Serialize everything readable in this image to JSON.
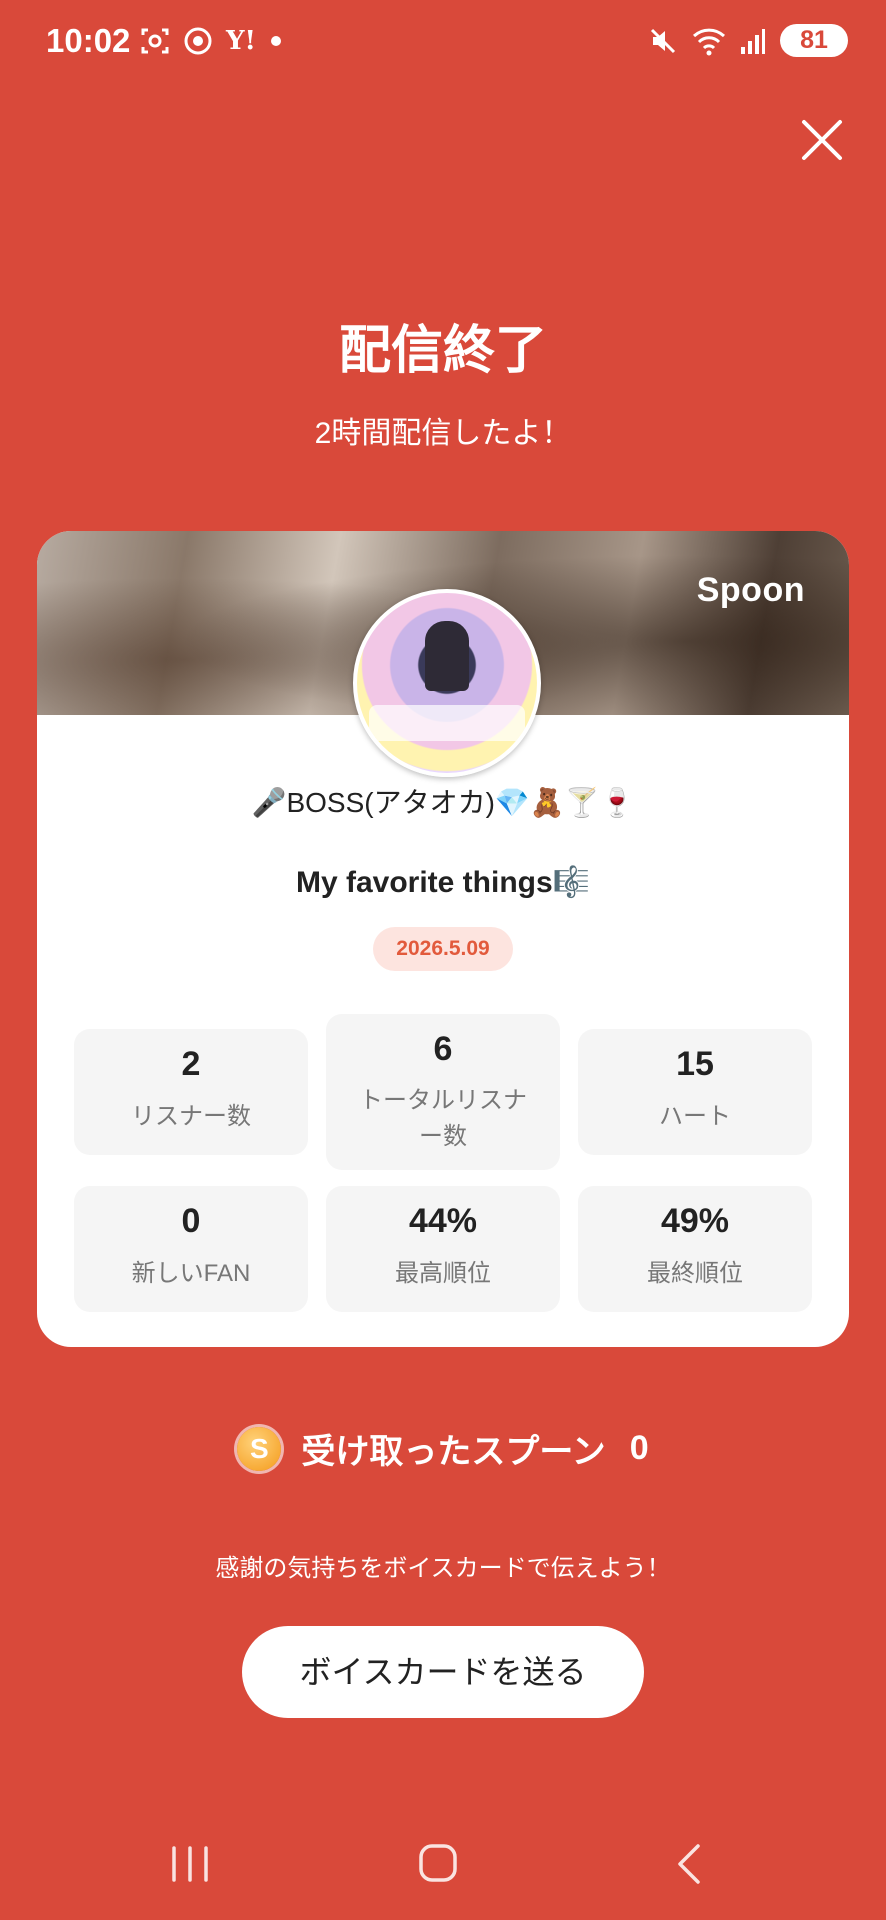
{
  "status_bar": {
    "time": "10:02",
    "yahoo_label": "Y!",
    "battery": "81"
  },
  "header": {
    "title": "配信終了",
    "subtitle": "2時間配信したよ！"
  },
  "card": {
    "brand": "Spoon",
    "host_name": "🎤BOSS(アタオカ)💎🧸🍸🍷",
    "live_title": "My favorite things🎼",
    "date": "2026.5.09",
    "stats": [
      {
        "value": "2",
        "label": "リスナー数"
      },
      {
        "value": "6",
        "label": "トータルリスナー数"
      },
      {
        "value": "15",
        "label": "ハート"
      },
      {
        "value": "0",
        "label": "新しいFAN"
      },
      {
        "value": "44%",
        "label": "最高順位"
      },
      {
        "value": "49%",
        "label": "最終順位"
      }
    ]
  },
  "spoons": {
    "icon": "S",
    "label": "受け取ったスプーン",
    "count": "0"
  },
  "thanks_text": "感謝の気持ちをボイスカードで伝えよう！",
  "voice_card_button": "ボイスカードを送る",
  "colors": {
    "background": "#d9493a",
    "accent": "#e25a3c"
  }
}
